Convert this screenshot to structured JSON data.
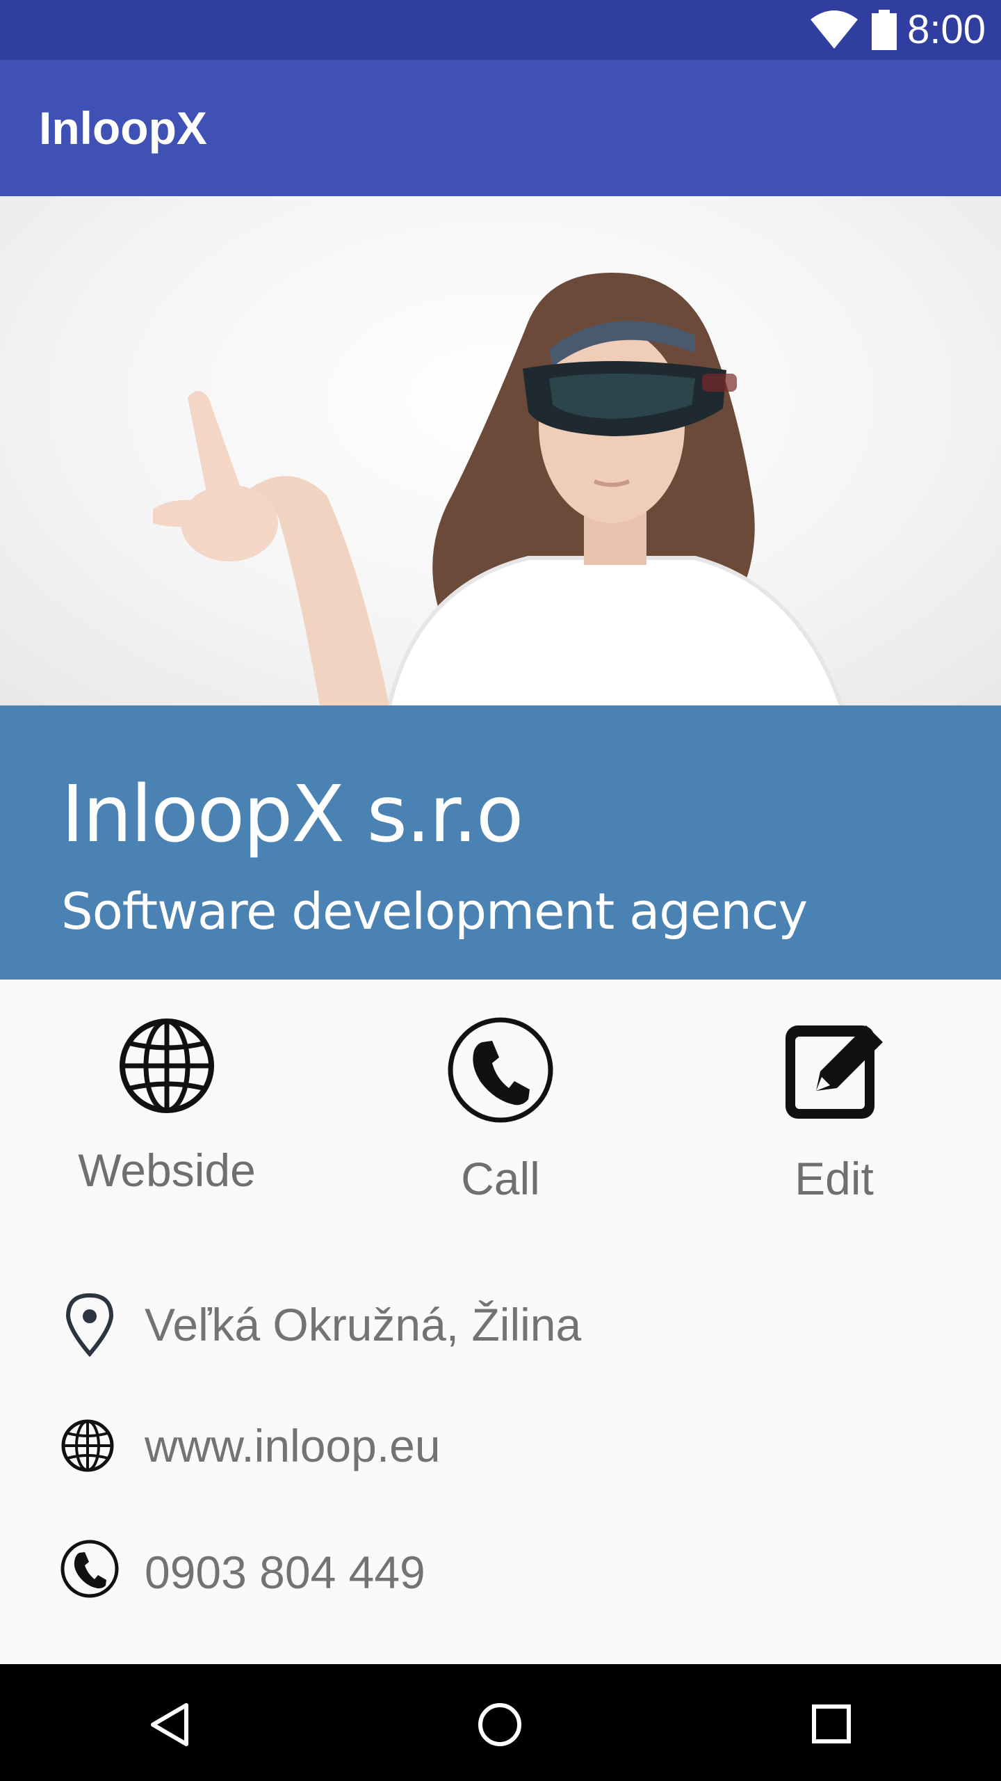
{
  "status_bar": {
    "time": "8:00",
    "icons": [
      "wifi-icon",
      "battery-icon"
    ]
  },
  "app_bar": {
    "title": "InloopX"
  },
  "hero": {
    "image": "woman-wearing-mixed-reality-headset"
  },
  "banner": {
    "company": "InloopX s.r.o",
    "tagline": "Software development agency",
    "background": "#4a82b4"
  },
  "actions": [
    {
      "label": "Webside",
      "icon": "globe-icon"
    },
    {
      "label": "Call",
      "icon": "phone-icon"
    },
    {
      "label": "Edit",
      "icon": "edit-icon"
    }
  ],
  "info": {
    "address": "Veľká Okružná, Žilina",
    "website": "www.inloop.eu",
    "phone": "0903 804 449"
  },
  "nav_bar": {
    "icons": [
      "back-icon",
      "home-icon",
      "recents-icon"
    ]
  },
  "colors": {
    "primary": "#3f51b5",
    "primary_dark": "#303f9f",
    "text_secondary": "#737373"
  }
}
